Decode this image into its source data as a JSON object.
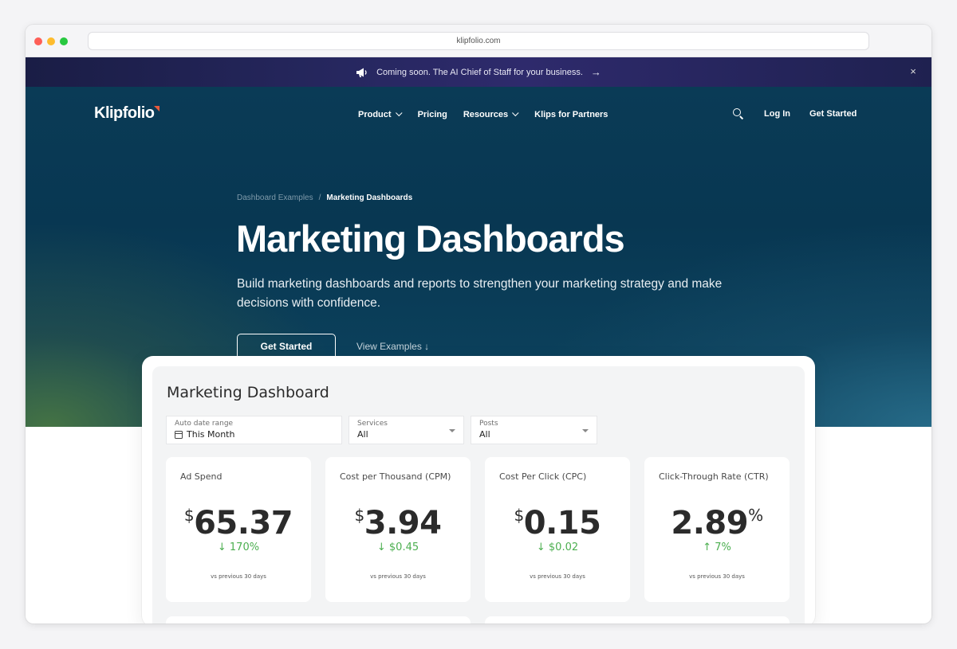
{
  "browser": {
    "url": "klipfolio.com"
  },
  "announcement": {
    "text": "Coming soon. The AI Chief of Staff for your business.",
    "arrow": "→",
    "close": "×"
  },
  "header": {
    "logo": "Klipfolio",
    "nav": [
      {
        "label": "Product",
        "has_menu": true
      },
      {
        "label": "Pricing",
        "has_menu": false
      },
      {
        "label": "Resources",
        "has_menu": true
      },
      {
        "label": "Klips for Partners",
        "has_menu": false
      }
    ],
    "login": "Log In",
    "get_started": "Get Started"
  },
  "breadcrumb": {
    "parent": "Dashboard Examples",
    "separator": "/",
    "current": "Marketing Dashboards"
  },
  "hero": {
    "title": "Marketing Dashboards",
    "subtitle": "Build marketing dashboards and reports to strengthen your marketing strategy and make decisions with confidence.",
    "primary_button": "Get Started",
    "secondary_link": "View Examples ↓"
  },
  "dashboard": {
    "title": "Marketing Dashboard",
    "filters": [
      {
        "label": "Auto date range",
        "value": "This Month",
        "icon": "calendar-icon"
      },
      {
        "label": "Services",
        "value": "All"
      },
      {
        "label": "Posts",
        "value": "All"
      }
    ],
    "metrics": [
      {
        "label": "Ad Spend",
        "prefix": "$",
        "value": "65.37",
        "suffix": "",
        "delta": "↓ 170%",
        "footnote": "vs previous 30 days"
      },
      {
        "label": "Cost per Thousand (CPM)",
        "prefix": "$",
        "value": "3.94",
        "suffix": "",
        "delta": "↓ $0.45",
        "footnote": "vs previous 30 days"
      },
      {
        "label": "Cost Per Click (CPC)",
        "prefix": "$",
        "value": "0.15",
        "suffix": "",
        "delta": "↓ $0.02",
        "footnote": "vs previous 30 days"
      },
      {
        "label": "Click-Through Rate (CTR)",
        "prefix": "",
        "value": "2.89",
        "suffix": "%",
        "delta": "↑ 7%",
        "footnote": "vs previous 30 days"
      }
    ]
  },
  "colors": {
    "accent_green": "#4caf50",
    "logo_mark": "#e85a3c"
  }
}
